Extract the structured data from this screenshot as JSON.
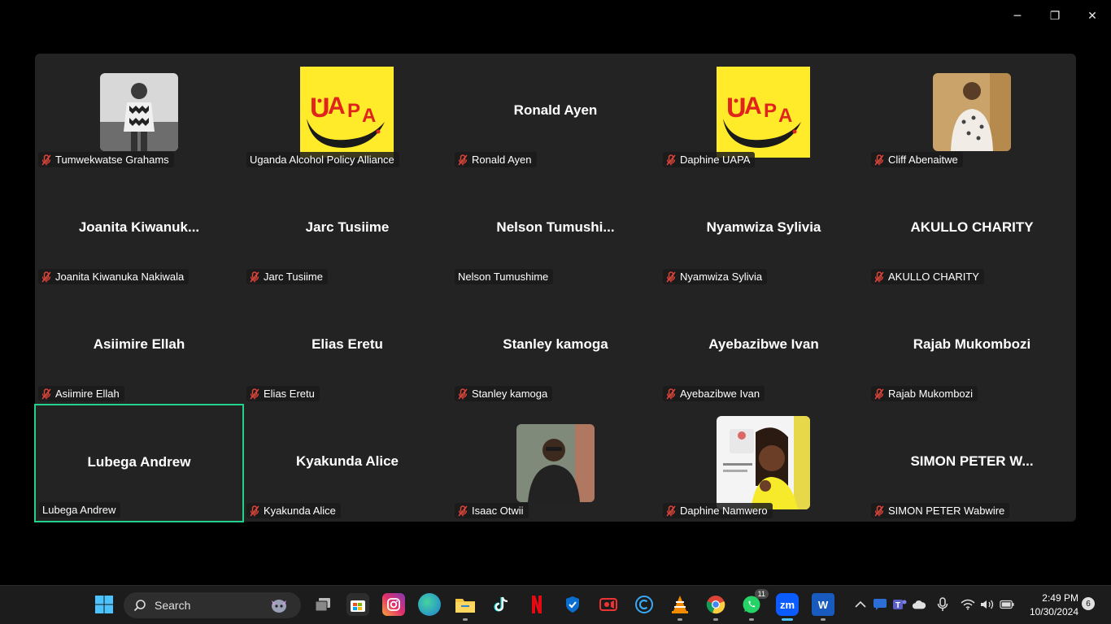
{
  "window_controls": {
    "minimize": "─",
    "restore": "❐",
    "close": "✕"
  },
  "participants": [
    {
      "display_name": "",
      "label": "Tumwekwatse Grahams",
      "muted": true,
      "photo": "person-photo-1"
    },
    {
      "display_name": "",
      "label": "Uganda Alcohol Policy Alliance",
      "muted": false,
      "photo": "uapa-logo"
    },
    {
      "display_name": "Ronald Ayen",
      "label": "Ronald Ayen",
      "muted": true
    },
    {
      "display_name": "",
      "label": "Daphine UAPA",
      "muted": true,
      "photo": "uapa-logo"
    },
    {
      "display_name": "",
      "label": "Cliff Abenaitwe",
      "muted": true,
      "photo": "person-photo-2"
    },
    {
      "display_name": "Joanita  Kiwanuk...",
      "label": "Joanita Kiwanuka Nakiwala",
      "muted": true
    },
    {
      "display_name": "Jarc Tusiime",
      "label": "Jarc Tusiime",
      "muted": true
    },
    {
      "display_name": "Nelson  Tumushi...",
      "label": "Nelson Tumushime",
      "muted": false
    },
    {
      "display_name": "Nyamwiza Sylivia",
      "label": "Nyamwiza Sylivia",
      "muted": true
    },
    {
      "display_name": "AKULLO CHARITY",
      "label": "AKULLO CHARITY",
      "muted": true
    },
    {
      "display_name": "Asiimire Ellah",
      "label": "Asiimire Ellah",
      "muted": true
    },
    {
      "display_name": "Elias Eretu",
      "label": "Elias Eretu",
      "muted": true
    },
    {
      "display_name": "Stanley kamoga",
      "label": "Stanley kamoga",
      "muted": true
    },
    {
      "display_name": "Ayebazibwe Ivan",
      "label": "Ayebazibwe Ivan",
      "muted": true
    },
    {
      "display_name": "Rajab Mukombozi",
      "label": "Rajab Mukombozi",
      "muted": true
    },
    {
      "display_name": "Lubega Andrew",
      "label": "Lubega Andrew",
      "muted": false,
      "active_speaker": true
    },
    {
      "display_name": "Kyakunda Alice",
      "label": "Kyakunda Alice",
      "muted": true
    },
    {
      "display_name": "",
      "label": "Isaac Otwii",
      "muted": true,
      "photo": "person-photo-3"
    },
    {
      "display_name": "",
      "label": "Daphine Namwero",
      "muted": true,
      "photo": "person-photo-4"
    },
    {
      "display_name": "SIMON PETER W...",
      "label": "SIMON PETER Wabwire",
      "muted": true
    }
  ],
  "taskbar": {
    "search_label": "Search",
    "whatsapp_badge": "11",
    "zoom_label": "zm",
    "word_label": "W",
    "clock_time": "2:49 PM",
    "clock_date": "10/30/2024",
    "notification_count": "6"
  },
  "colors": {
    "active_speaker_border": "#23d18b",
    "uapa_yellow": "#ffeb2a",
    "mute_red": "#e0453a"
  }
}
